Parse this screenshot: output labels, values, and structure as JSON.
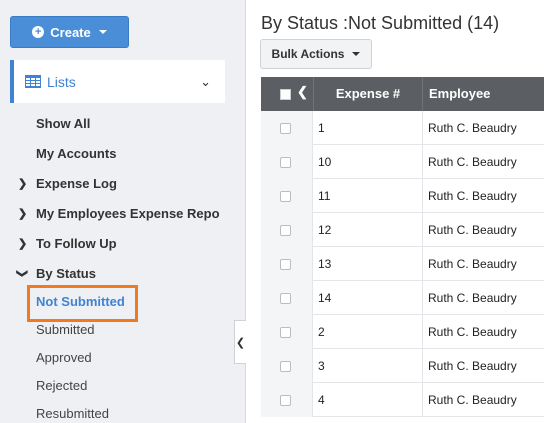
{
  "sidebar": {
    "create_label": "Create",
    "lists_label": "Lists",
    "items": [
      {
        "label": "Show All",
        "type": "top"
      },
      {
        "label": "My Accounts",
        "type": "top"
      },
      {
        "label": "Expense Log",
        "type": "group",
        "arrow": "›"
      },
      {
        "label": "My Employees Expense Repo",
        "type": "group",
        "arrow": "›"
      },
      {
        "label": "To Follow Up",
        "type": "group",
        "arrow": "›"
      },
      {
        "label": "By Status",
        "type": "group-open",
        "arrow": "⌄"
      },
      {
        "label": "Not Submitted",
        "type": "active"
      },
      {
        "label": "Submitted",
        "type": "sub"
      },
      {
        "label": "Approved",
        "type": "sub"
      },
      {
        "label": "Rejected",
        "type": "sub"
      },
      {
        "label": "Resubmitted",
        "type": "sub"
      }
    ]
  },
  "main": {
    "title": "By Status :Not Submitted (14)",
    "bulk_actions_label": "Bulk Actions",
    "columns": {
      "expense": "Expense #",
      "employee": "Employee"
    },
    "rows": [
      {
        "expense": "1",
        "employee": "Ruth C. Beaudry"
      },
      {
        "expense": "10",
        "employee": "Ruth C. Beaudry"
      },
      {
        "expense": "11",
        "employee": "Ruth C. Beaudry"
      },
      {
        "expense": "12",
        "employee": "Ruth C. Beaudry"
      },
      {
        "expense": "13",
        "employee": "Ruth C. Beaudry"
      },
      {
        "expense": "14",
        "employee": "Ruth C. Beaudry"
      },
      {
        "expense": "2",
        "employee": "Ruth C. Beaudry"
      },
      {
        "expense": "3",
        "employee": "Ruth C. Beaudry"
      },
      {
        "expense": "4",
        "employee": "Ruth C. Beaudry"
      }
    ]
  },
  "colors": {
    "accent": "#3f83d4",
    "create_button": "#4a8ed8",
    "highlight": "#ef7a1f",
    "table_header": "#5b5f64"
  },
  "icons": {
    "create": "plus-circle-icon",
    "lists": "table-grid-icon",
    "collapse": "chevron-left-icon"
  }
}
